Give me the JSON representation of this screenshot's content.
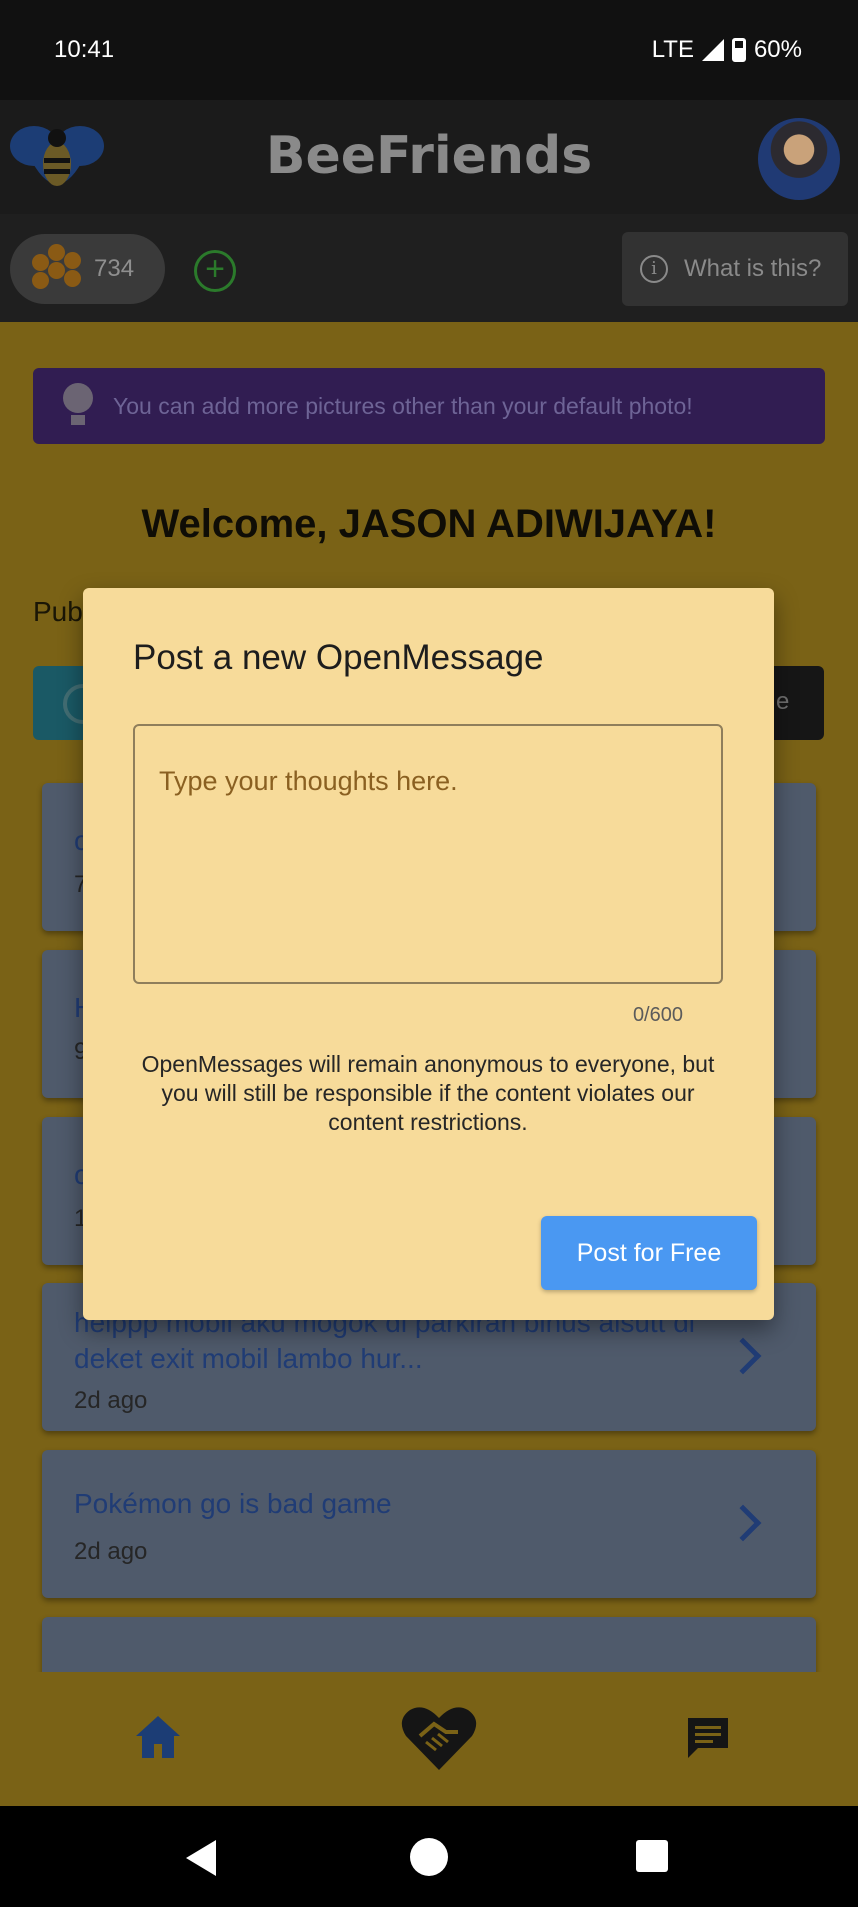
{
  "status_bar": {
    "time": "10:41",
    "network": "LTE",
    "battery": "60%"
  },
  "header": {
    "title": "BeeFriends"
  },
  "toolbar": {
    "honey_count": "734",
    "what_label": "What is this?"
  },
  "tip": {
    "text": "You can add more pictures other than your default photo!"
  },
  "welcome": {
    "text": "Welcome, JASON ADIWIJAYA!"
  },
  "section": {
    "label": "Pub",
    "right_button_partial": "e"
  },
  "list": {
    "items": [
      {
        "title": "c",
        "time": "7"
      },
      {
        "title": "H",
        "time": "9"
      },
      {
        "title": "c",
        "time": "1"
      },
      {
        "title": "helppp mobil aku mogok di parkiran binus alsutt di deket exit mobil lambo hur...",
        "time": "2d ago"
      },
      {
        "title": "Pokémon go is bad game",
        "time": "2d ago"
      }
    ]
  },
  "dialog": {
    "title": "Post a new OpenMessage",
    "placeholder": "Type your thoughts here.",
    "counter": "0/600",
    "disclaimer": "OpenMessages will remain anonymous to everyone, but you will still be responsible if the content violates our content restrictions.",
    "post_button": "Post for Free"
  },
  "icons": {
    "logo": "bee-logo-icon",
    "honey": "honeycomb-icon",
    "add": "plus-circle-icon",
    "info": "info-icon",
    "tip": "lightbulb-icon",
    "chevron": "chevron-right-icon",
    "home": "home-icon",
    "match": "handshake-heart-icon",
    "chat": "chat-icon"
  },
  "colors": {
    "accent_blue": "#4a98f2",
    "dialog_bg": "#f7db9a",
    "page_bg": "#7a6216"
  }
}
